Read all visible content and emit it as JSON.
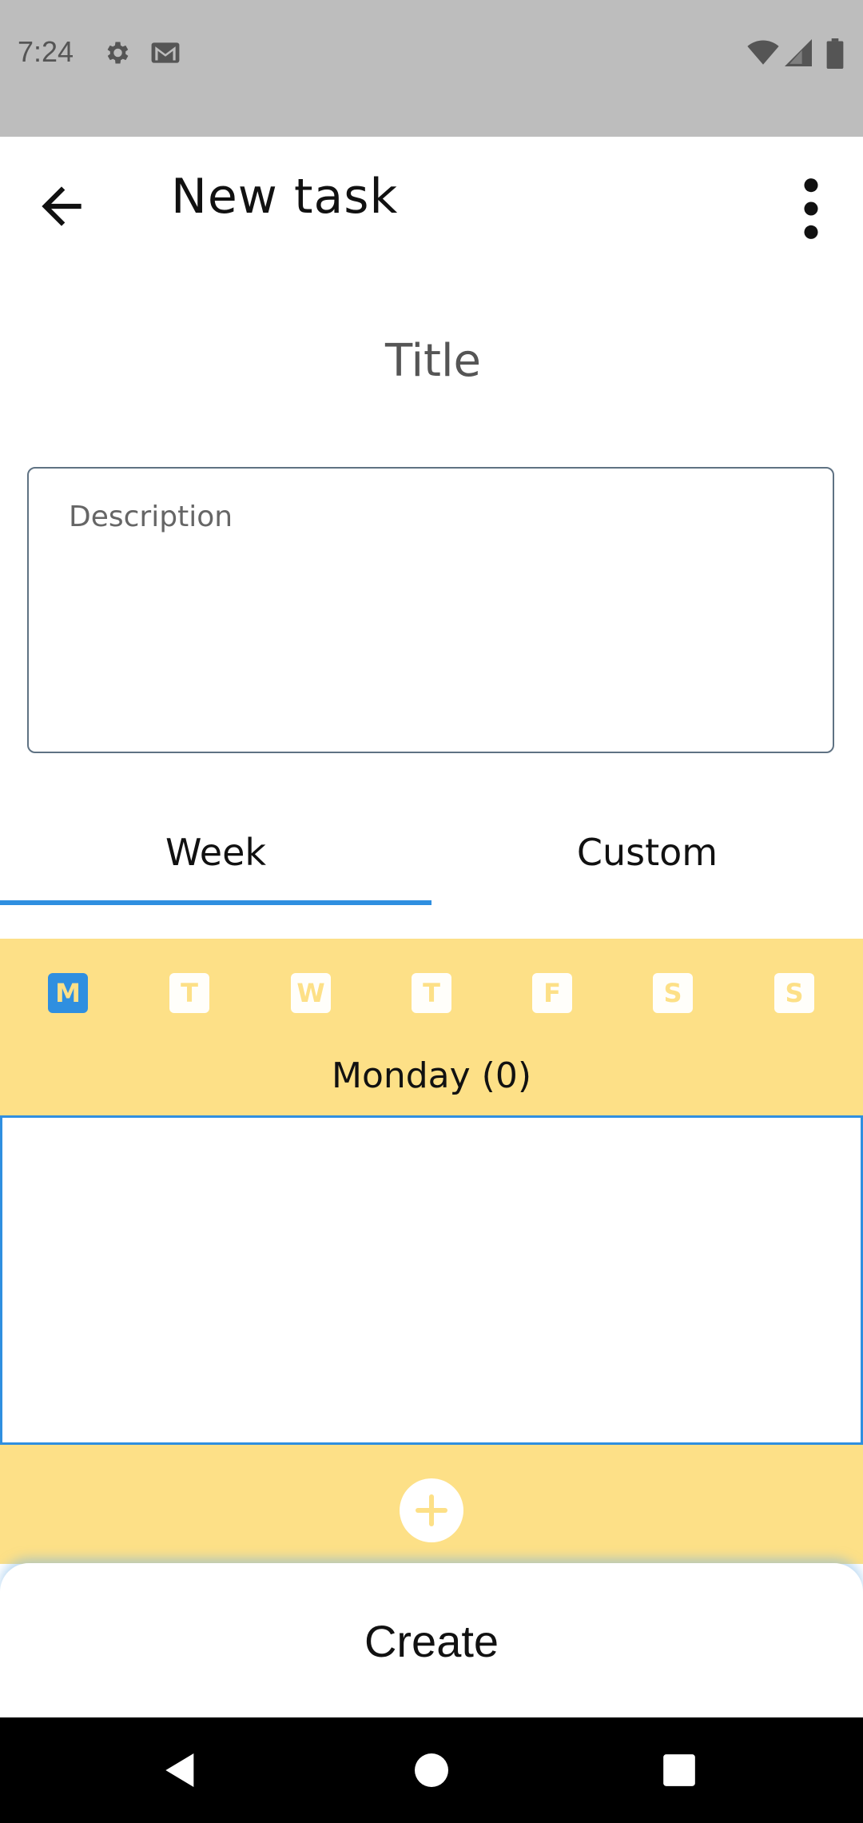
{
  "status_bar": {
    "time": "7:24",
    "icons": [
      "settings-icon",
      "gmail-icon",
      "wifi-icon",
      "signal-icon",
      "battery-icon"
    ]
  },
  "app_bar": {
    "title": "New task",
    "back_icon": "arrow-back-icon",
    "menu_icon": "more-vert-icon"
  },
  "form": {
    "title_placeholder": "Title",
    "description_placeholder": "Description"
  },
  "tabs": [
    {
      "label": "Week",
      "selected": true
    },
    {
      "label": "Custom",
      "selected": false
    }
  ],
  "week": {
    "days": [
      {
        "letter": "M",
        "selected": true
      },
      {
        "letter": "T",
        "selected": false
      },
      {
        "letter": "W",
        "selected": false
      },
      {
        "letter": "T",
        "selected": false
      },
      {
        "letter": "F",
        "selected": false
      },
      {
        "letter": "S",
        "selected": false
      },
      {
        "letter": "S",
        "selected": false
      }
    ],
    "heading": "Monday (0)",
    "add_icon": "plus-icon"
  },
  "actions": {
    "create_label": "Create"
  },
  "nav_bar": {
    "icons": [
      "nav-back-icon",
      "nav-home-icon",
      "nav-recents-icon"
    ]
  },
  "colors": {
    "accent": "#2f8fe0",
    "panel": "#fde087",
    "status_bar": "#bdbdbd",
    "text": "#111111"
  }
}
